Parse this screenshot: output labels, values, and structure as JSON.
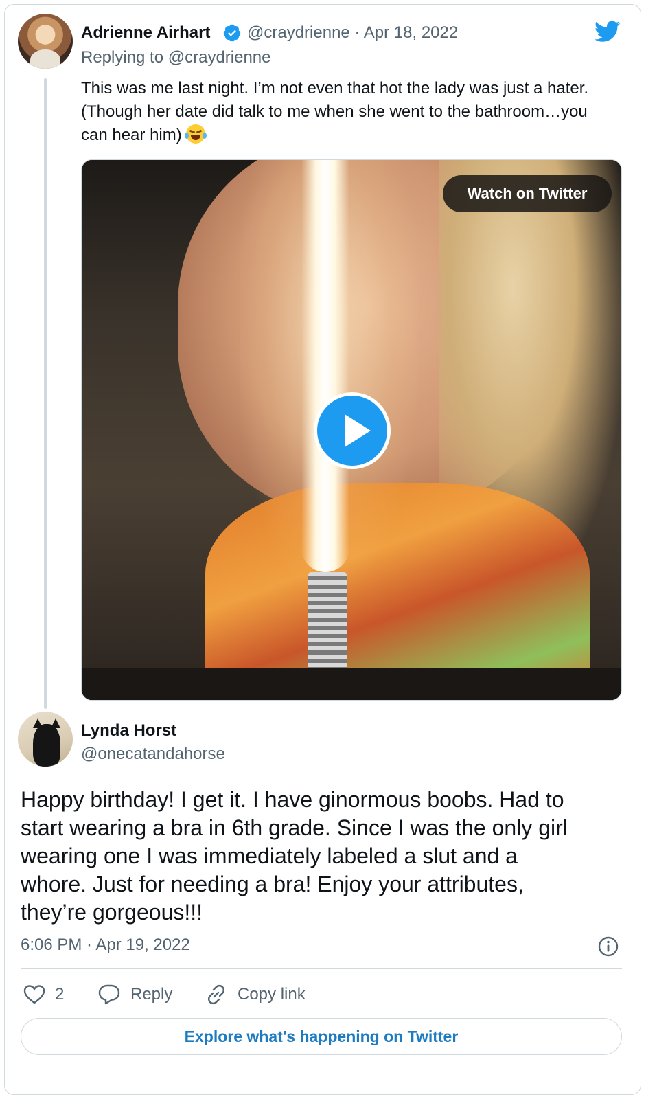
{
  "tweet1": {
    "display_name": "Adrienne Airhart",
    "handle_date": "@craydrienne · Apr 18, 2022",
    "replying_to": "Replying to @craydrienne",
    "text": "This was me last night. I’m not even that hot the lady was just a hater.\n(Though her date did talk to me when she went to the bathroom…you\ncan hear him) ",
    "emoji_icon": "face-with-tears-of-joy-emoji",
    "media": {
      "watch_label": "Watch on Twitter",
      "play_icon": "play-icon"
    }
  },
  "tweet2": {
    "display_name": "Lynda Horst",
    "handle": "@onecatandahorse",
    "text": "Happy birthday!  I get it. I have ginormous boobs. Had to\nstart wearing a bra in 6th grade. Since I was the only girl\nwearing one I was immediately labeled a slut and a\nwhore. Just for needing a bra!  Enjoy your attributes,\nthey’re gorgeous!!!",
    "timestamp": "6:06 PM · Apr 19, 2022"
  },
  "actions": {
    "like_count": "2",
    "reply_label": "Reply",
    "copy_label": "Copy link"
  },
  "explore_label": "Explore what's happening on Twitter",
  "colors": {
    "twitter_blue": "#1d9bf0",
    "secondary_text": "#536471",
    "border": "#cfd9de"
  }
}
